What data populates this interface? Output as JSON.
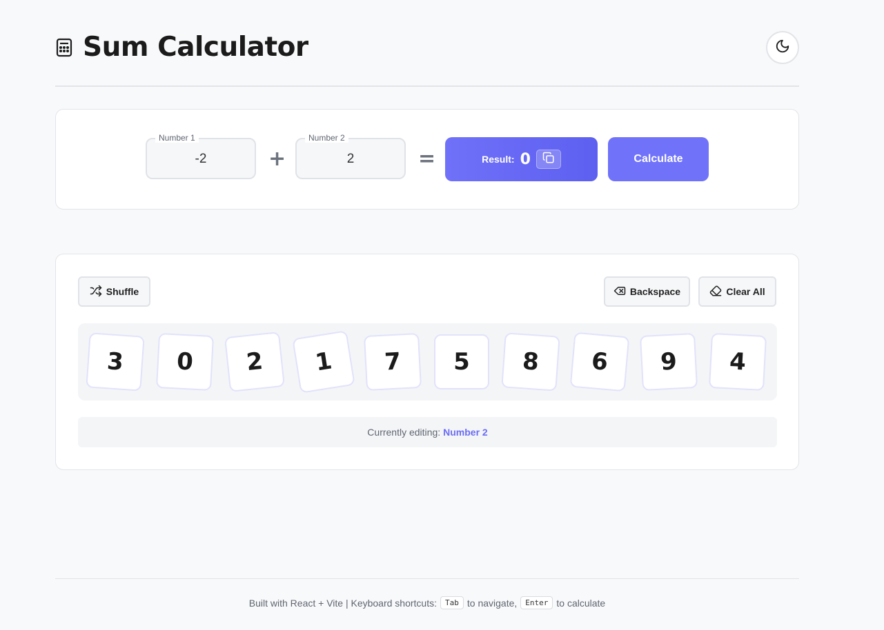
{
  "header": {
    "title": "Sum Calculator",
    "title_icon": "calculator-icon",
    "theme_toggle_icon": "moon-icon"
  },
  "calculator": {
    "number1": {
      "label": "Number 1",
      "value": "-2"
    },
    "number2": {
      "label": "Number 2",
      "value": "2"
    },
    "plus_symbol": "+",
    "equals_symbol": "=",
    "result": {
      "label": "Result:",
      "value": "0",
      "copy_icon": "copy-icon"
    },
    "calculate_label": "Calculate",
    "accent_color": "#6c6ef5"
  },
  "keypad": {
    "shuffle_label": "Shuffle",
    "shuffle_icon": "shuffle-icon",
    "backspace_label": "Backspace",
    "backspace_icon": "backspace-icon",
    "clear_label": "Clear All",
    "clear_icon": "eraser-icon",
    "digits": [
      "3",
      "0",
      "2",
      "1",
      "7",
      "5",
      "8",
      "6",
      "9",
      "4"
    ],
    "status_prefix": "Currently editing:",
    "status_value": "Number 2"
  },
  "footer": {
    "text_before": "Built with React + Vite | Keyboard shortcuts:",
    "key1": "Tab",
    "text_middle": "to navigate,",
    "key2": "Enter",
    "text_after": "to calculate"
  }
}
